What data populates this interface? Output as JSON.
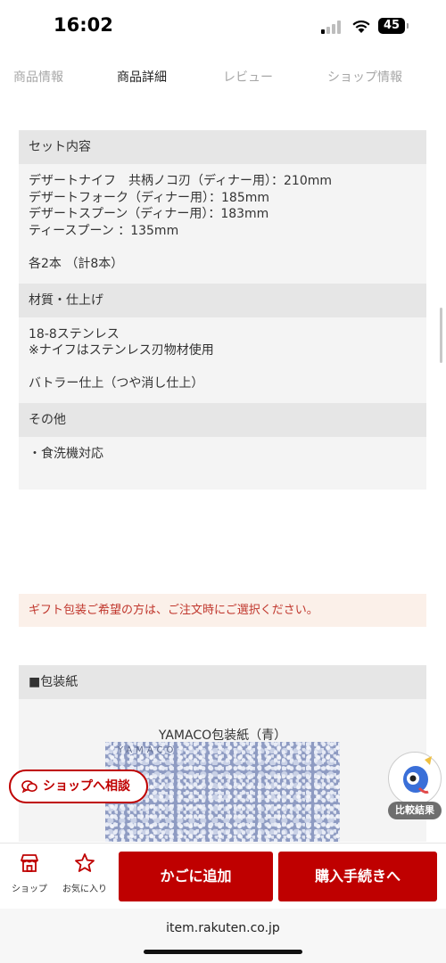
{
  "status": {
    "time": "16:02",
    "battery": "45"
  },
  "tabs": [
    {
      "label": "商品情報",
      "active": false
    },
    {
      "label": "商品詳細",
      "active": true
    },
    {
      "label": "レビュー",
      "active": false
    },
    {
      "label": "ショップ情報",
      "active": false
    }
  ],
  "sections": [
    {
      "heading": "セット内容",
      "lines": [
        "デザートナイフ　共柄ノコ刃（ディナー用）：210mm",
        "デザートフォーク（ディナー用）：185mm",
        "デザートスプーン（ディナー用）：183mm",
        "ティースプーン ：135mm",
        "",
        "各2本 （計8本）"
      ]
    },
    {
      "heading": "材質・仕上げ",
      "lines": [
        "18-8ステンレス",
        "※ナイフはステンレス刃物材使用",
        "",
        "バトラー仕上（つや消し仕上）"
      ]
    },
    {
      "heading": "その他",
      "lines": [
        "・食洗機対応"
      ]
    }
  ],
  "notice": "ギフト包装ご希望の方は、ご注文時にご選択ください。",
  "wrapping": {
    "heading": "■包装紙",
    "item_title": "YAMACO包装紙（青）",
    "image_text": "YAMACO"
  },
  "floating": {
    "consult_label": "ショップへ相談",
    "compare_label": "比較結果"
  },
  "action_bar": {
    "shop_label": "ショップ",
    "favorite_label": "お気に入り",
    "cart_label": "かごに追加",
    "buy_label": "購入手続きへ"
  },
  "browser": {
    "url": "item.rakuten.co.jp"
  },
  "colors": {
    "accent": "#bf0000",
    "notice_text": "#c0362c",
    "notice_bg": "#fbf0e9",
    "section_head_bg": "#e6e6e6",
    "section_body_bg": "#f4f4f4"
  }
}
